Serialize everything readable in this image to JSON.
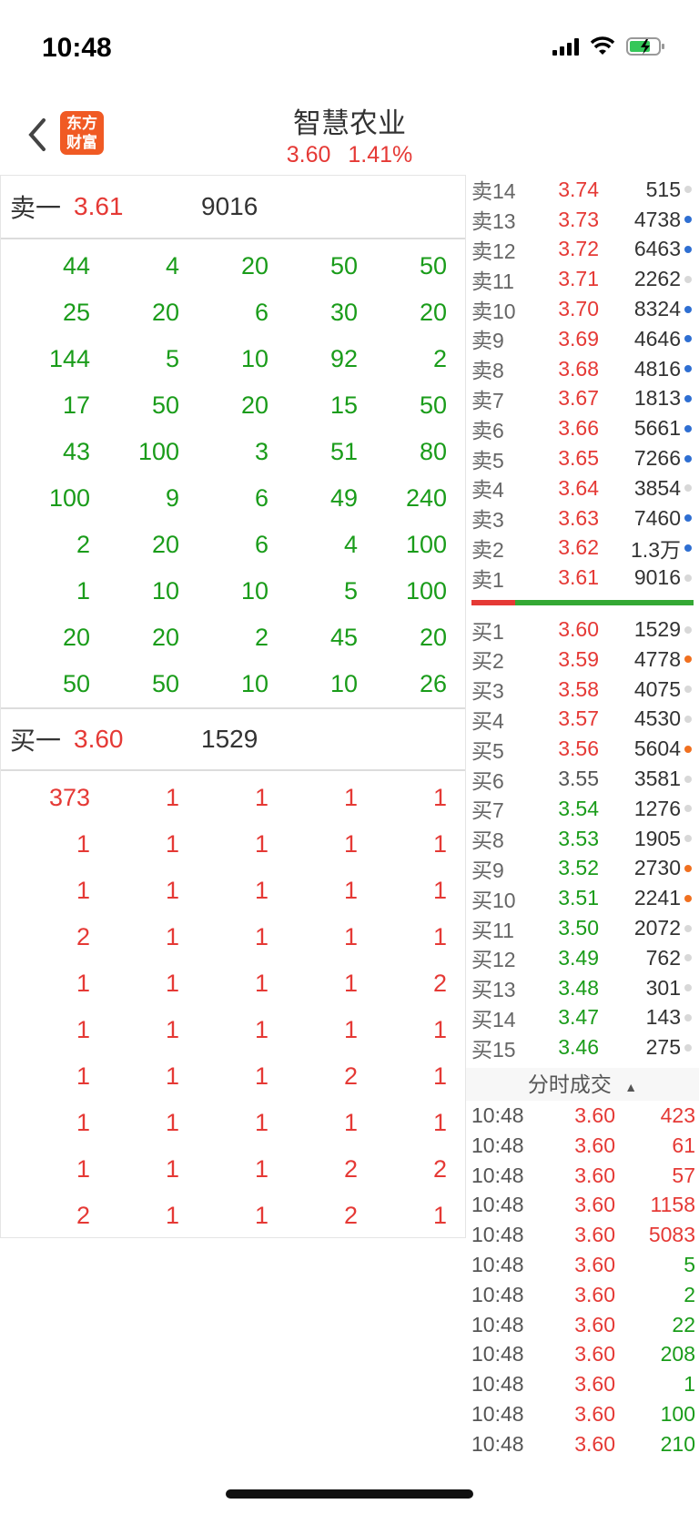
{
  "status": {
    "time": "10:48"
  },
  "header": {
    "title": "智慧农业",
    "price": "3.60",
    "change": "1.41%",
    "logo_line1": "东方",
    "logo_line2": "财富"
  },
  "sell_one": {
    "label": "卖一",
    "price": "3.61",
    "qty": "9016"
  },
  "sell_queue": [
    [
      "44",
      "4",
      "20",
      "50",
      "50"
    ],
    [
      "25",
      "20",
      "6",
      "30",
      "20"
    ],
    [
      "144",
      "5",
      "10",
      "92",
      "2"
    ],
    [
      "17",
      "50",
      "20",
      "15",
      "50"
    ],
    [
      "43",
      "100",
      "3",
      "51",
      "80"
    ],
    [
      "100",
      "9",
      "6",
      "49",
      "240"
    ],
    [
      "2",
      "20",
      "6",
      "4",
      "100"
    ],
    [
      "1",
      "10",
      "10",
      "5",
      "100"
    ],
    [
      "20",
      "20",
      "2",
      "45",
      "20"
    ],
    [
      "50",
      "50",
      "10",
      "10",
      "26"
    ]
  ],
  "buy_one": {
    "label": "买一",
    "price": "3.60",
    "qty": "1529"
  },
  "buy_queue": [
    [
      "373",
      "1",
      "1",
      "1",
      "1"
    ],
    [
      "1",
      "1",
      "1",
      "1",
      "1"
    ],
    [
      "1",
      "1",
      "1",
      "1",
      "1"
    ],
    [
      "2",
      "1",
      "1",
      "1",
      "1"
    ],
    [
      "1",
      "1",
      "1",
      "1",
      "2"
    ],
    [
      "1",
      "1",
      "1",
      "1",
      "1"
    ],
    [
      "1",
      "1",
      "1",
      "2",
      "1"
    ],
    [
      "1",
      "1",
      "1",
      "1",
      "1"
    ],
    [
      "1",
      "1",
      "1",
      "2",
      "2"
    ],
    [
      "2",
      "1",
      "1",
      "2",
      "1"
    ]
  ],
  "asks": [
    {
      "label": "卖14",
      "price": "3.74",
      "vol": "515",
      "dot": "g"
    },
    {
      "label": "卖13",
      "price": "3.73",
      "vol": "4738",
      "dot": "b"
    },
    {
      "label": "卖12",
      "price": "3.72",
      "vol": "6463",
      "dot": "b"
    },
    {
      "label": "卖11",
      "price": "3.71",
      "vol": "2262",
      "dot": "g"
    },
    {
      "label": "卖10",
      "price": "3.70",
      "vol": "8324",
      "dot": "b"
    },
    {
      "label": "卖9",
      "price": "3.69",
      "vol": "4646",
      "dot": "b"
    },
    {
      "label": "卖8",
      "price": "3.68",
      "vol": "4816",
      "dot": "b"
    },
    {
      "label": "卖7",
      "price": "3.67",
      "vol": "1813",
      "dot": "b"
    },
    {
      "label": "卖6",
      "price": "3.66",
      "vol": "5661",
      "dot": "b"
    },
    {
      "label": "卖5",
      "price": "3.65",
      "vol": "7266",
      "dot": "b"
    },
    {
      "label": "卖4",
      "price": "3.64",
      "vol": "3854",
      "dot": "g"
    },
    {
      "label": "卖3",
      "price": "3.63",
      "vol": "7460",
      "dot": "b"
    },
    {
      "label": "卖2",
      "price": "3.62",
      "vol": "1.3万",
      "dot": "b"
    },
    {
      "label": "卖1",
      "price": "3.61",
      "vol": "9016",
      "dot": "g"
    }
  ],
  "bids": [
    {
      "label": "买1",
      "price": "3.60",
      "vol": "1529",
      "dot": "g",
      "color": "red"
    },
    {
      "label": "买2",
      "price": "3.59",
      "vol": "4778",
      "dot": "o",
      "color": "red"
    },
    {
      "label": "买3",
      "price": "3.58",
      "vol": "4075",
      "dot": "g",
      "color": "red"
    },
    {
      "label": "买4",
      "price": "3.57",
      "vol": "4530",
      "dot": "g",
      "color": "red"
    },
    {
      "label": "买5",
      "price": "3.56",
      "vol": "5604",
      "dot": "o",
      "color": "red"
    },
    {
      "label": "买6",
      "price": "3.55",
      "vol": "3581",
      "dot": "g",
      "color": "gray"
    },
    {
      "label": "买7",
      "price": "3.54",
      "vol": "1276",
      "dot": "g",
      "color": "green"
    },
    {
      "label": "买8",
      "price": "3.53",
      "vol": "1905",
      "dot": "g",
      "color": "green"
    },
    {
      "label": "买9",
      "price": "3.52",
      "vol": "2730",
      "dot": "o",
      "color": "green"
    },
    {
      "label": "买10",
      "price": "3.51",
      "vol": "2241",
      "dot": "o",
      "color": "green"
    },
    {
      "label": "买11",
      "price": "3.50",
      "vol": "2072",
      "dot": "g",
      "color": "green"
    },
    {
      "label": "买12",
      "price": "3.49",
      "vol": "762",
      "dot": "g",
      "color": "green"
    },
    {
      "label": "买13",
      "price": "3.48",
      "vol": "301",
      "dot": "g",
      "color": "green"
    },
    {
      "label": "买14",
      "price": "3.47",
      "vol": "143",
      "dot": "g",
      "color": "green"
    },
    {
      "label": "买15",
      "price": "3.46",
      "vol": "275",
      "dot": "g",
      "color": "green"
    }
  ],
  "trades_title": "分时成交",
  "trades": [
    {
      "time": "10:48",
      "price": "3.60",
      "vol": "423",
      "color": "red"
    },
    {
      "time": "10:48",
      "price": "3.60",
      "vol": "61",
      "color": "red"
    },
    {
      "time": "10:48",
      "price": "3.60",
      "vol": "57",
      "color": "red"
    },
    {
      "time": "10:48",
      "price": "3.60",
      "vol": "1158",
      "color": "red"
    },
    {
      "time": "10:48",
      "price": "3.60",
      "vol": "5083",
      "color": "red"
    },
    {
      "time": "10:48",
      "price": "3.60",
      "vol": "5",
      "color": "green"
    },
    {
      "time": "10:48",
      "price": "3.60",
      "vol": "2",
      "color": "green"
    },
    {
      "time": "10:48",
      "price": "3.60",
      "vol": "22",
      "color": "green"
    },
    {
      "time": "10:48",
      "price": "3.60",
      "vol": "208",
      "color": "green"
    },
    {
      "time": "10:48",
      "price": "3.60",
      "vol": "1",
      "color": "green"
    },
    {
      "time": "10:48",
      "price": "3.60",
      "vol": "100",
      "color": "green"
    },
    {
      "time": "10:48",
      "price": "3.60",
      "vol": "210",
      "color": "green"
    }
  ],
  "colors": {
    "up": "#e53935",
    "down": "#1a9c1a",
    "brand": "#f05a24"
  }
}
